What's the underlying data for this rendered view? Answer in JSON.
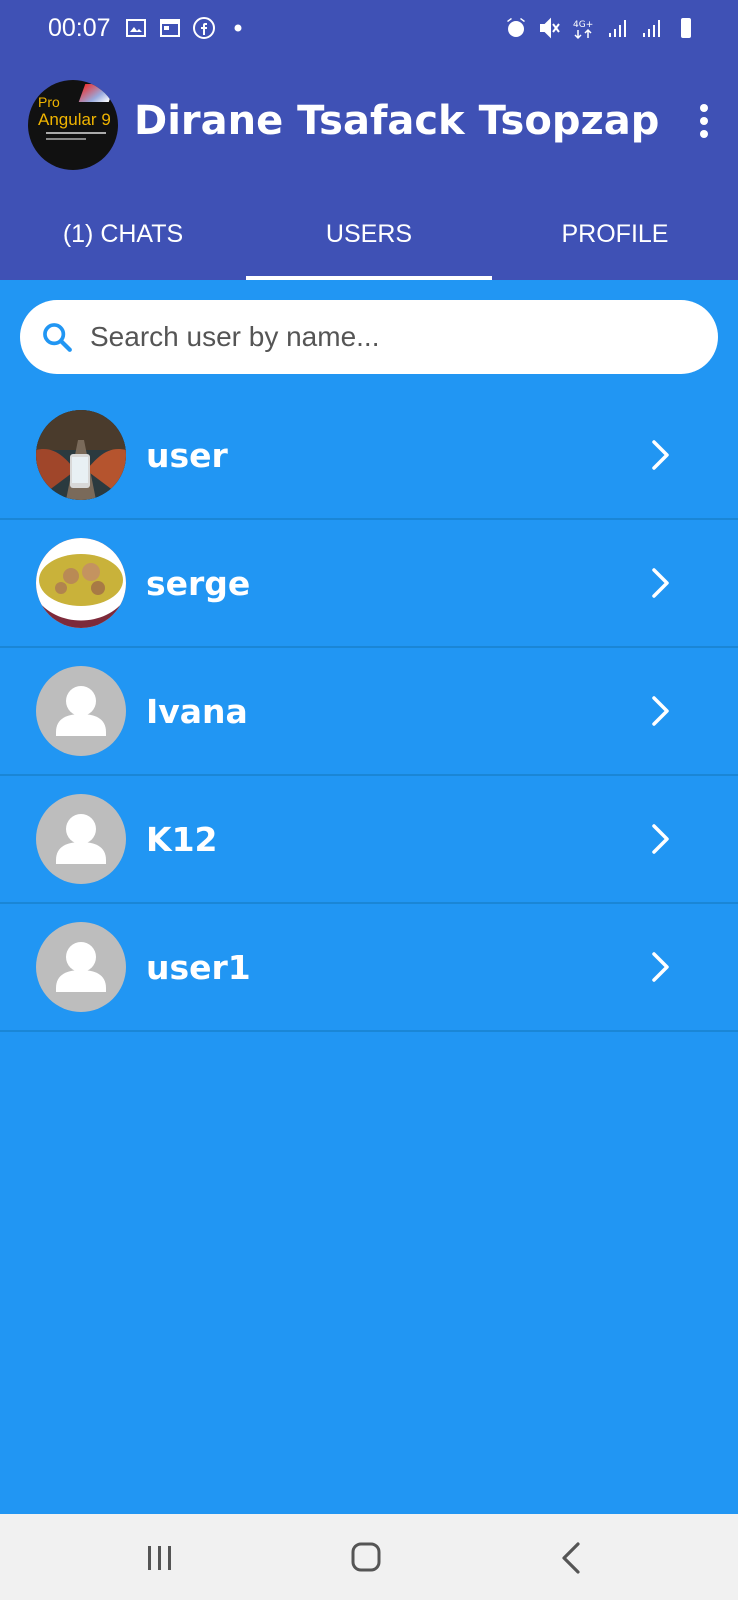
{
  "status_bar": {
    "time": "00:07",
    "left_icons": [
      "image-icon",
      "calendar-icon",
      "facebook-icon",
      "dot-icon"
    ],
    "right_icons": [
      "alarm-icon",
      "mute-icon",
      "4g-icon",
      "signal-icon",
      "signal-icon",
      "battery-icon"
    ],
    "network_label": "4G+"
  },
  "app_bar": {
    "title": "Dirane Tsafack Tsopzap",
    "avatar_text_1": "Pro",
    "avatar_text_2": "Angular 9"
  },
  "tabs": [
    {
      "label": "(1) CHATS",
      "active": false
    },
    {
      "label": "USERS",
      "active": true
    },
    {
      "label": "PROFILE",
      "active": false
    }
  ],
  "search": {
    "placeholder": "Search user by name..."
  },
  "users": [
    {
      "name": "user",
      "avatar": "photo-road"
    },
    {
      "name": "serge",
      "avatar": "photo-food"
    },
    {
      "name": "Ivana",
      "avatar": "default"
    },
    {
      "name": "K12",
      "avatar": "default"
    },
    {
      "name": "user1",
      "avatar": "default"
    }
  ],
  "nav_bar": {
    "buttons": [
      "recent-apps-icon",
      "home-icon",
      "back-icon"
    ]
  },
  "colors": {
    "primary": "#3f51b5",
    "background": "#2196f3",
    "divider": "#1a86d6",
    "avatar_default": "#bdbdbd"
  }
}
